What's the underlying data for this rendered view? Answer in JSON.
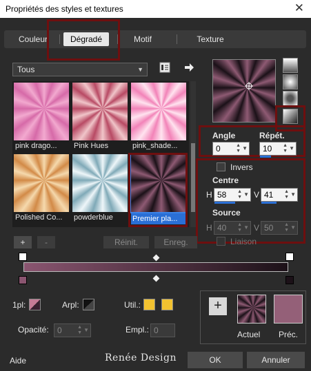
{
  "window": {
    "title": "Propriétés des styles et textures",
    "close": "✕"
  },
  "tabs": [
    {
      "label": "Couleur"
    },
    {
      "label": "Dégradé"
    },
    {
      "label": "Motif"
    },
    {
      "label": "Texture"
    }
  ],
  "category": {
    "value": "Tous"
  },
  "gallery": {
    "items": [
      {
        "label": "pink drago...",
        "c1": "#f2a9cf",
        "c2": "#d66aa8"
      },
      {
        "label": "Pink Hues",
        "c1": "#f0c5c9",
        "c2": "#b84a64"
      },
      {
        "label": "pink_shade...",
        "c1": "#ffe3ef",
        "c2": "#f283b8"
      },
      {
        "label": "Polished Co...",
        "c1": "#f5d9ad",
        "c2": "#d28a47"
      },
      {
        "label": "powderblue",
        "c1": "#eef6f9",
        "c2": "#7fa9b7"
      },
      {
        "label": "Premier pla...",
        "c1": "#8e5a73",
        "c2": "#1b1118"
      }
    ]
  },
  "angle": {
    "label": "Angle",
    "value": "0"
  },
  "repeat": {
    "label": "Répét.",
    "value": "10"
  },
  "invert": {
    "label": "Invers"
  },
  "center": {
    "label": "Centre",
    "h_label": "H",
    "h_value": "58",
    "v_label": "V",
    "v_value": "41"
  },
  "source": {
    "label": "Source",
    "h_label": "H",
    "h_value": "40",
    "v_label": "V",
    "v_value": "50"
  },
  "link": {
    "label": "Liaison"
  },
  "buttons": {
    "add": "+",
    "remove": "-",
    "reset": "Réinit.",
    "save": "Enreg."
  },
  "bottom": {
    "fg_label": "1pl:",
    "bg_label": "Arpl:",
    "util_label": "Util.:",
    "opacity_label": "Opacité:",
    "opacity_value": "0",
    "location_label": "Empl.:",
    "location_value": "0",
    "current_label": "Actuel",
    "previous_label": "Préc.",
    "add_symbol": "+"
  },
  "footer": {
    "help": "Aide",
    "brand": "Renée Design",
    "ok": "OK",
    "cancel": "Annuler"
  },
  "colors": {
    "gradient_start": "#8a5570",
    "gradient_end": "#1c1118",
    "util_swatch": "#f2c230",
    "previous": "#946078",
    "highlight": "#6e0f0f",
    "selection": "#2a6fd6"
  }
}
